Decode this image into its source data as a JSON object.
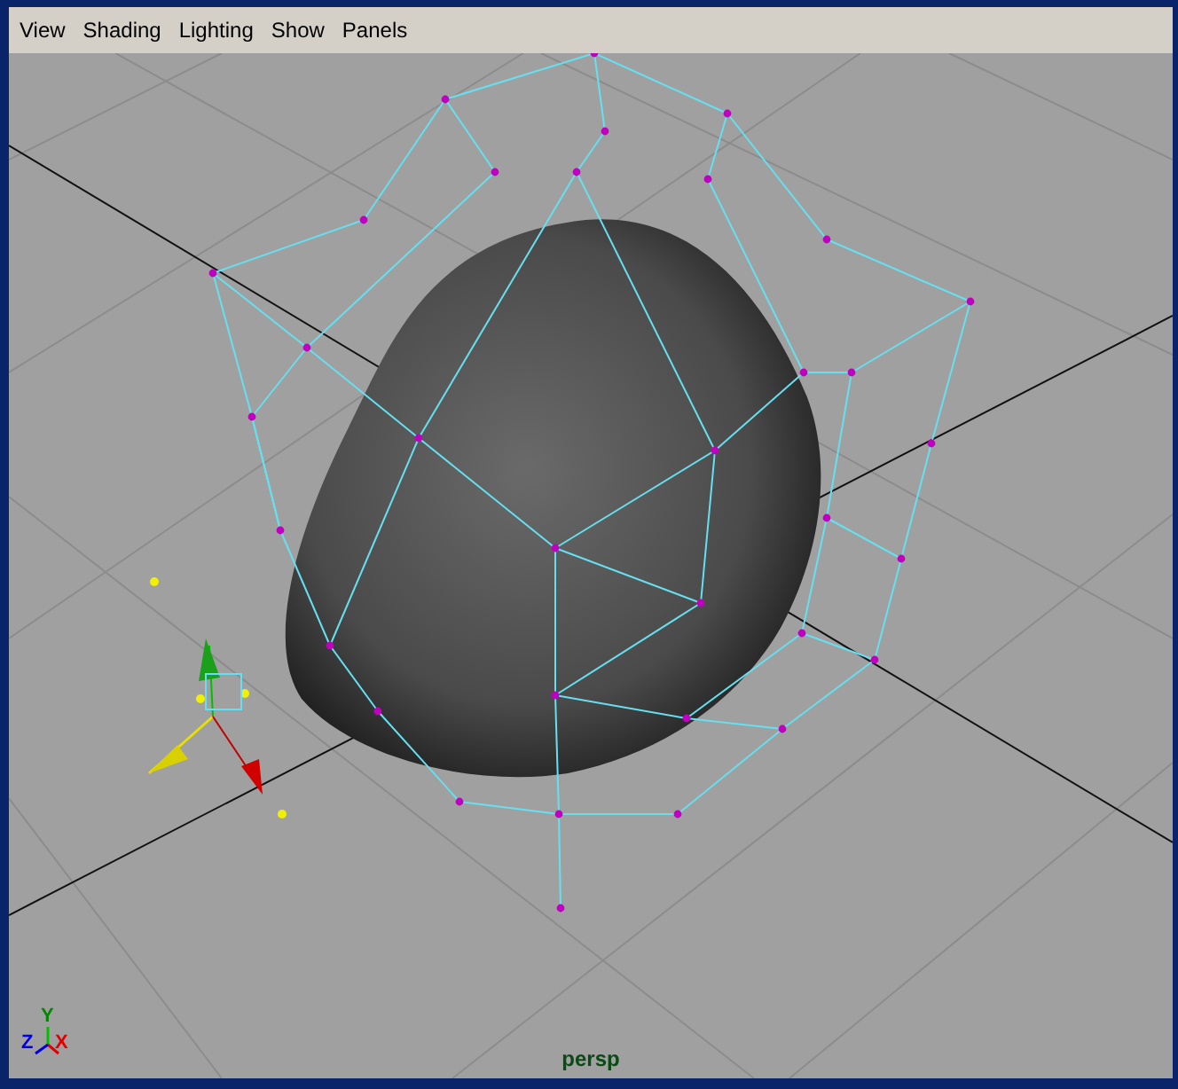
{
  "menu_bar": {
    "items": [
      "View",
      "Shading",
      "Lighting",
      "Show",
      "Panels"
    ]
  },
  "viewport": {
    "camera_label": "persp",
    "axis_labels": [
      {
        "kind": "y",
        "text": "Y"
      },
      {
        "kind": "z",
        "text": "Z"
      },
      {
        "kind": "x",
        "text": "X"
      }
    ]
  }
}
